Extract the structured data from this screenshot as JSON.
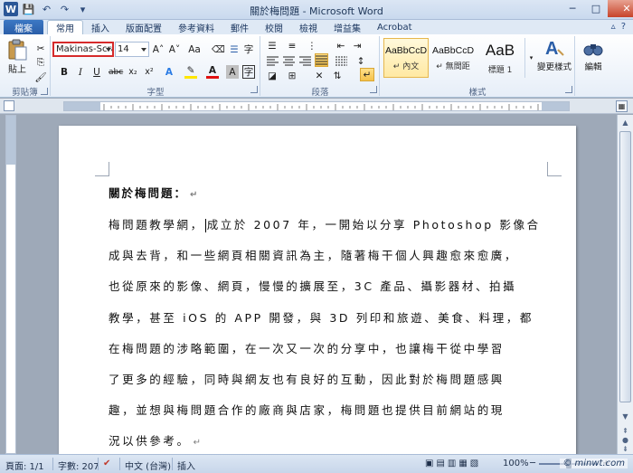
{
  "window": {
    "title": "關於梅問題 - Microsoft Word",
    "qat": [
      "W",
      "💾",
      "↶",
      "↷",
      "▾"
    ],
    "controls": {
      "minimize": "─",
      "maximize": "□",
      "close": "✕"
    }
  },
  "tabs": {
    "file": "檔案",
    "items": [
      "常用",
      "插入",
      "版面配置",
      "參考資料",
      "郵件",
      "校閱",
      "檢視",
      "增益集",
      "Acrobat"
    ],
    "right_icons": [
      "▵",
      "?"
    ]
  },
  "ribbon": {
    "clipboard": {
      "paste": "貼上",
      "label": "剪貼簿"
    },
    "font": {
      "name": "Makinas-Scra",
      "size": "14",
      "grow": "A˄",
      "shrink": "A˅",
      "clear": "Aa",
      "phonetic": "☰",
      "enclose": "字",
      "bold": "B",
      "italic": "I",
      "underline": "U",
      "strike": "abc",
      "sub": "x₂",
      "sup": "x²",
      "effect": "A",
      "highlight": "✎",
      "color": "A",
      "shade": "A",
      "border": "字",
      "label": "字型"
    },
    "paragraph": {
      "label": "段落",
      "marks": "↵"
    },
    "styles": {
      "items": [
        {
          "sample": "AaBbCcD",
          "name": "↵ 內文"
        },
        {
          "sample": "AaBbCcD",
          "name": "↵ 無間距"
        },
        {
          "sample": "AaB",
          "name": "標題 1"
        }
      ],
      "change": "變更樣式",
      "label": "樣式"
    },
    "editing": {
      "label": "編輯"
    }
  },
  "document": {
    "title": "關於梅問題：",
    "lines": [
      "梅問題教學網，",
      "成立於 2007 年，一開始以分享 Photoshop 影像合",
      "成與去背，和一些網頁相關資訊為主，隨著梅干個人興趣愈來愈廣，",
      "也從原來的影像、網頁，慢慢的擴展至，3C 產品、攝影器材、拍攝",
      "教學，甚至 iOS 的 APP 開發，與 3D 列印和旅遊、美食、料理，都",
      "在梅問題的涉略範圍，在一次又一次的分享中，也讓梅干從中學習",
      "了更多的經驗，同時與網友也有良好的互動，因此對於梅問題感興",
      "趣，並想與梅問題合作的廠商與店家，梅問題也提供目前網站的現",
      "況以供參考。"
    ],
    "para_mark": "↵"
  },
  "statusbar": {
    "page": "頁面: 1/1",
    "words": "字數: 207",
    "lang": "中文 (台灣)",
    "mode": "插入",
    "zoom": "100%",
    "zoom_out": "─",
    "zoom_in": "+"
  },
  "watermark": "© minwt.com"
}
